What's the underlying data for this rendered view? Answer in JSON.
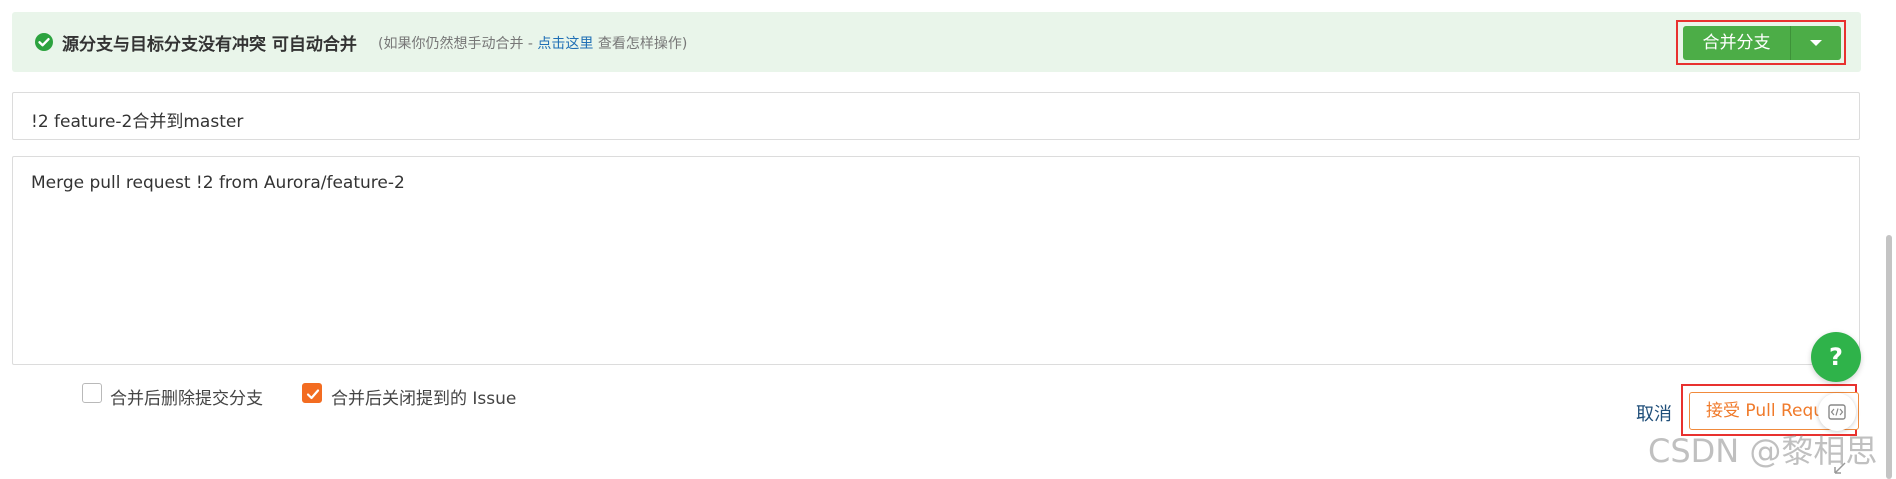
{
  "banner": {
    "message": "源分支与目标分支没有冲突 可自动合并",
    "hint_prefix": "(如果你仍然想手动合并 - ",
    "hint_link": "点击这里",
    "hint_suffix": " 查看怎样操作)",
    "merge_button": "合并分支"
  },
  "form": {
    "title_value": "!2 feature-2合并到master",
    "body_value": "Merge pull request !2 from Aurora/feature-2"
  },
  "options": {
    "delete_branch": {
      "label": "合并后删除提交分支",
      "checked": false
    },
    "close_issue": {
      "label": "合并后关闭提到的 Issue",
      "checked": true
    }
  },
  "actions": {
    "cancel": "取消",
    "accept": "接受 Pull Request",
    "help": "?"
  },
  "watermark": "CSDN @黎相思",
  "colors": {
    "success_green": "#4cad47",
    "banner_bg": "#e9f5ea",
    "accent_orange": "#f36c21",
    "highlight_red": "#e8312f",
    "link_blue": "#1f6fb5"
  }
}
